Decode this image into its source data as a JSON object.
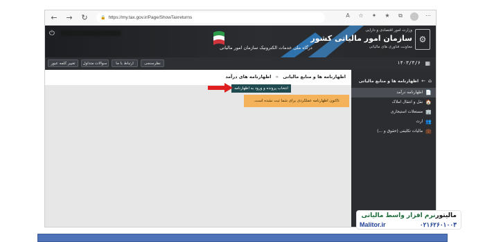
{
  "browser": {
    "url": "https://my.tax.gov.ir/Page/ShowTaxreturns",
    "back": "←",
    "forward": "→",
    "reload": "↻"
  },
  "header": {
    "org_sup": "وزارت امور اقتصادی و دارایی",
    "org_name": "سازمان امور مالیاتی کشور",
    "org_sub": "معاونت فناوری های مالیاتی",
    "portal_title": "درگاه ملی خدمات الکترونیک سازمان امور مالیاتی",
    "date": "۱۴۰۳/۳/۶"
  },
  "topbar": {
    "buttons": [
      "تغییر کلمه عبور",
      "سوالات متداول",
      "ارتباط با ما",
      "نظرسنجی"
    ]
  },
  "sidebar": {
    "title": "اظهارنامه ها و منابع مالیاتی",
    "items": [
      {
        "label": "اظهارنامه درآمد",
        "icon": "📄"
      },
      {
        "label": "نقل و انتقال املاک",
        "icon": "🏠"
      },
      {
        "label": "مستغلات استیجاری",
        "icon": "🏢"
      },
      {
        "label": "ارث",
        "icon": "👥"
      },
      {
        "label": "مالیات تکلیفی (حقوق و ...)",
        "icon": "💼"
      }
    ]
  },
  "content": {
    "breadcrumb_root": "اظهارنامه ها و منابع مالیاتی",
    "breadcrumb_sep": "»",
    "breadcrumb_current": "اظهارنامه های درآمد",
    "select_button": "انتخاب پرونده و ورود به اظهارنامه",
    "alert": "تاکنون اظهارنامه عملکردی برای شما ثبت نشده است."
  },
  "badge": {
    "brand": "مالیتور",
    "tagline": "نرم افزار واسط مالیاتی",
    "site": "Malitor.ir",
    "phone": "۰۲۱۶۲۶۰۱۰۰۳"
  }
}
